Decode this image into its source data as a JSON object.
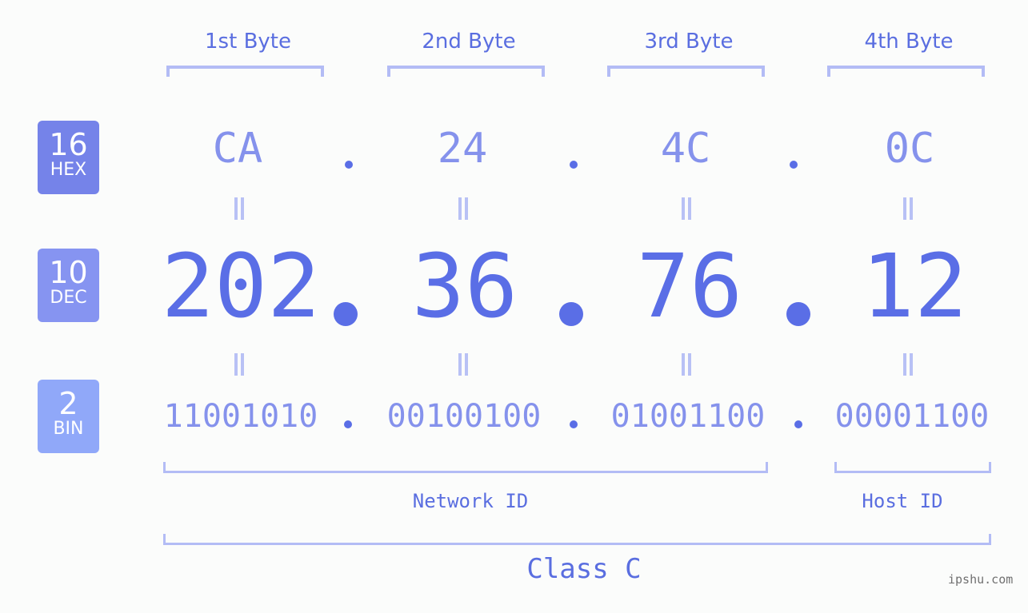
{
  "byte_headers": [
    "1st Byte",
    "2nd Byte",
    "3rd Byte",
    "4th Byte"
  ],
  "badges": [
    {
      "num": "16",
      "label": "HEX",
      "color": "#7583e9"
    },
    {
      "num": "10",
      "label": "DEC",
      "color": "#8694f1"
    },
    {
      "num": "2",
      "label": "BIN",
      "color": "#90a8f9"
    }
  ],
  "hex": [
    "CA",
    "24",
    "4C",
    "0C"
  ],
  "dec": [
    "202",
    "36",
    "76",
    "12"
  ],
  "bin": [
    "11001010",
    "00100100",
    "01001100",
    "00001100"
  ],
  "separator": ".",
  "equals_symbol": "=",
  "network_id_label": "Network ID",
  "host_id_label": "Host ID",
  "class_label": "Class C",
  "watermark": "ipshu.com"
}
